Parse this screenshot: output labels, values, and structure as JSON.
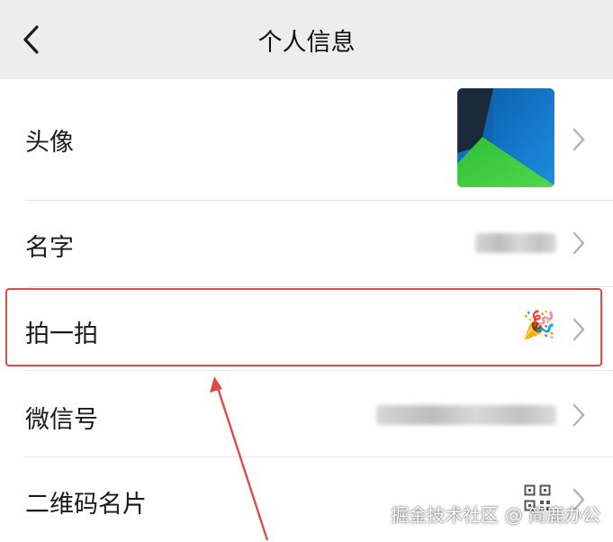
{
  "header": {
    "title": "个人信息",
    "back_icon": "chevron-left-icon"
  },
  "rows": [
    {
      "label": "头像",
      "value_type": "avatar-image"
    },
    {
      "label": "名字",
      "value_type": "blurred-text"
    },
    {
      "label": "拍一拍",
      "value_type": "emoji",
      "value": "🎉"
    },
    {
      "label": "微信号",
      "value_type": "blurred-text"
    },
    {
      "label": "二维码名片",
      "value_type": "qr-code-icon"
    }
  ],
  "annotation": {
    "highlight_color": "#e14b47",
    "highlighted_row": "拍一拍"
  },
  "watermark": "掘金技术社区 @ 简鹿办公",
  "colors": {
    "navbar_bg": "#ededed",
    "divider": "#e5e5e5",
    "chevron": "#b2b2b2",
    "annotation_red": "#e14b47"
  }
}
